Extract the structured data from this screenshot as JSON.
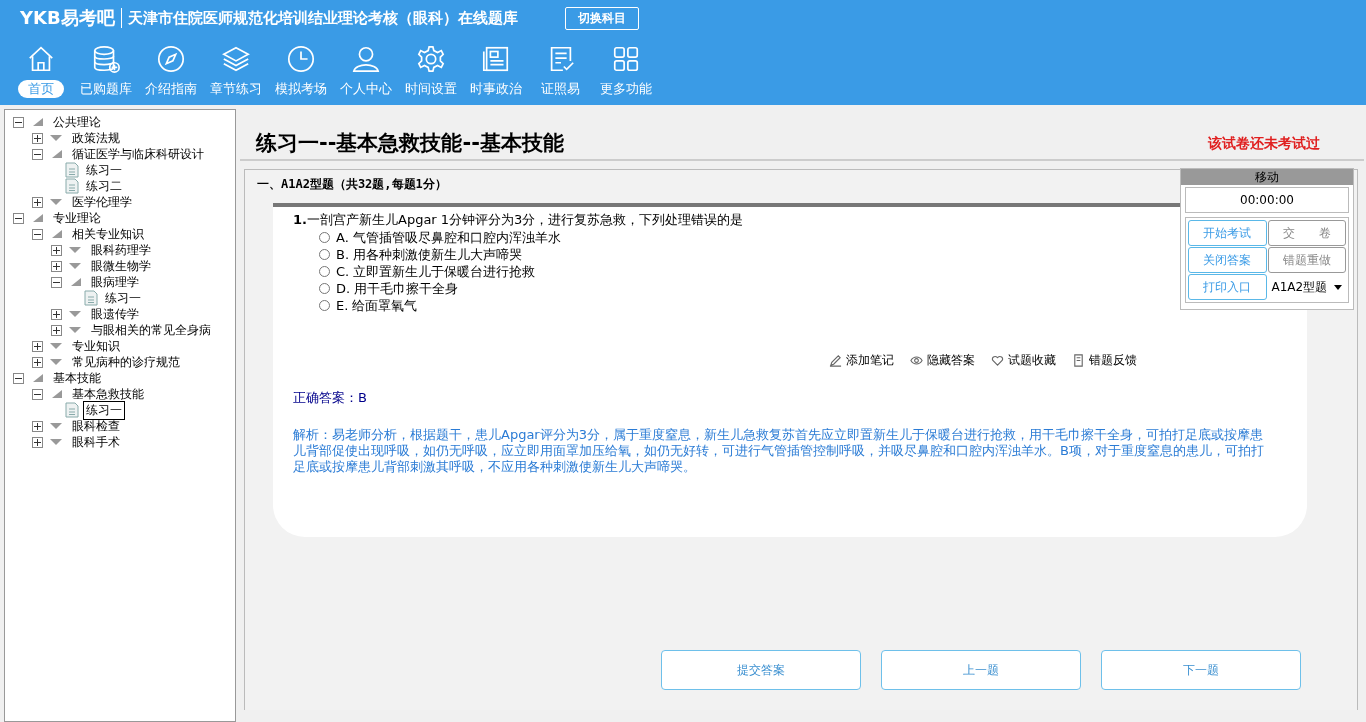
{
  "header": {
    "logo": "YKB易考吧",
    "title": "天津市住院医师规范化培训结业理论考核（眼科）在线题库",
    "switch_button": "切换科目"
  },
  "nav": [
    {
      "label": "首页",
      "selected": true
    },
    {
      "label": "已购题库",
      "selected": false
    },
    {
      "label": "介绍指南",
      "selected": false
    },
    {
      "label": "章节练习",
      "selected": false
    },
    {
      "label": "模拟考场",
      "selected": false
    },
    {
      "label": "个人中心",
      "selected": false
    },
    {
      "label": "时间设置",
      "selected": false
    },
    {
      "label": "时事政治",
      "selected": false
    },
    {
      "label": "证照易",
      "selected": false
    },
    {
      "label": "更多功能",
      "selected": false
    }
  ],
  "tree": [
    {
      "label": "公共理论",
      "expanded": true,
      "children": [
        {
          "label": "政策法规",
          "expanded": false
        },
        {
          "label": "循证医学与临床科研设计",
          "expanded": true,
          "children": [
            {
              "label": "练习一",
              "kind": "leaf",
              "selected": false
            },
            {
              "label": "练习二",
              "kind": "leaf",
              "selected": false
            }
          ]
        },
        {
          "label": "医学伦理学",
          "expanded": false
        }
      ]
    },
    {
      "label": "专业理论",
      "expanded": true,
      "children": [
        {
          "label": "相关专业知识",
          "expanded": true,
          "children": [
            {
              "label": "眼科药理学",
              "expanded": false
            },
            {
              "label": "眼微生物学",
              "expanded": false
            },
            {
              "label": "眼病理学",
              "expanded": true,
              "children": [
                {
                  "label": "练习一",
                  "kind": "leaf",
                  "selected": false
                }
              ]
            },
            {
              "label": "眼遗传学",
              "expanded": false
            },
            {
              "label": "与眼相关的常见全身病",
              "expanded": false
            }
          ]
        },
        {
          "label": "专业知识",
          "expanded": false
        },
        {
          "label": "常见病种的诊疗规范",
          "expanded": false
        }
      ]
    },
    {
      "label": "基本技能",
      "expanded": true,
      "children": [
        {
          "label": "基本急救技能",
          "expanded": true,
          "children": [
            {
              "label": "练习一",
              "kind": "leaf",
              "selected": true
            }
          ]
        },
        {
          "label": "眼科检查",
          "expanded": false
        },
        {
          "label": "眼科手术",
          "expanded": false
        }
      ]
    }
  ],
  "paper": {
    "title": "练习一--基本急救技能--基本技能",
    "status": "该试卷还未考试过",
    "section": "一、A1A2型题（共32题,每题1分）"
  },
  "question": {
    "number": "1.",
    "text": "一剖宫产新生儿Apgar 1分钟评分为3分，进行复苏急救，下列处理错误的是",
    "options": [
      {
        "label": "A. 气管插管吸尽鼻腔和口腔内浑浊羊水",
        "checked": false
      },
      {
        "label": "B. 用各种刺激使新生儿大声啼哭",
        "checked": false
      },
      {
        "label": "C. 立即置新生儿于保暖台进行抢救",
        "checked": false
      },
      {
        "label": "D. 用干毛巾擦干全身",
        "checked": false
      },
      {
        "label": "E. 给面罩氧气",
        "checked": false
      }
    ],
    "actions": [
      "添加笔记",
      "隐藏答案",
      "试题收藏",
      "错题反馈"
    ],
    "answer": "正确答案：B",
    "analysis": "解析：易老师分析，根据题干，患儿Apgar评分为3分，属于重度窒息，新生儿急救复苏首先应立即置新生儿于保暖台进行抢救，用干毛巾擦干全身，可拍打足底或按摩患儿背部促使出现呼吸，如仍无呼吸，应立即用面罩加压给氧，如仍无好转，可进行气管插管控制呼吸，并吸尽鼻腔和口腔内浑浊羊水。B项，对于重度窒息的患儿，可拍打足底或按摩患儿背部刺激其呼吸，不应用各种刺激使新生儿大声啼哭。"
  },
  "control": {
    "title": "移动",
    "timer": "00:00:00",
    "buttons": [
      {
        "label": "开始考试",
        "disabled": false
      },
      {
        "label": "交　　卷",
        "disabled": true
      },
      {
        "label": "关闭答案",
        "disabled": false
      },
      {
        "label": "错题重做",
        "disabled": true
      },
      {
        "label": "打印入口",
        "disabled": false
      }
    ],
    "type_select": "A1A2型题"
  },
  "bottom_buttons": [
    "提交答案",
    "上一题",
    "下一题"
  ]
}
